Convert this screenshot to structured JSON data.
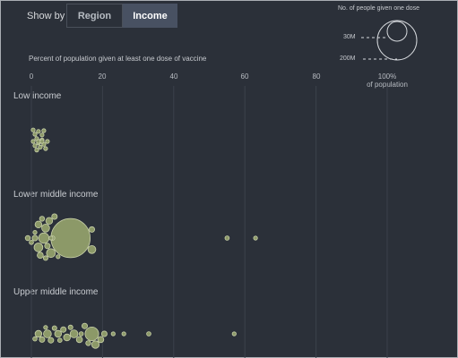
{
  "controls": {
    "show_by_label": "Show by",
    "options": [
      "Region",
      "Income"
    ],
    "selected": "Income"
  },
  "legend": {
    "title": "No. of people given one dose",
    "sizes": [
      "30M",
      "200M"
    ]
  },
  "colors": {
    "background": "#2b3039",
    "bubble_fill": "#8c9968",
    "bubble_stroke": "#c9d1a9",
    "gridline": "#3b414b",
    "accent_button": "#485162"
  },
  "chart_data": {
    "type": "scatter",
    "encoding": "beeswarm bubble chart, bubble size = people given one dose",
    "xlabel": "Percent of population given at least one dose of vaccine",
    "xlim": [
      0,
      100
    ],
    "xticks": [
      "0",
      "20",
      "40",
      "60",
      "80",
      "100%"
    ],
    "xtick_suffix": "of population",
    "groups": [
      {
        "name": "Low income",
        "countries": [
          {
            "x": 0.5,
            "size_m": 0.3
          },
          {
            "x": 1.0,
            "size_m": 0.3
          },
          {
            "x": 1.5,
            "size_m": 0.4
          },
          {
            "x": 2.0,
            "size_m": 0.3
          },
          {
            "x": 2.5,
            "size_m": 0.4
          },
          {
            "x": 3.0,
            "size_m": 0.3
          },
          {
            "x": 3.5,
            "size_m": 0.3
          },
          {
            "x": 1.0,
            "size_m": 0.4
          },
          {
            "x": 2.0,
            "size_m": 0.3
          },
          {
            "x": 3.0,
            "size_m": 0.4
          },
          {
            "x": 4.0,
            "size_m": 0.3
          },
          {
            "x": 1.5,
            "size_m": 0.3
          },
          {
            "x": 2.5,
            "size_m": 0.3
          },
          {
            "x": 3.5,
            "size_m": 0.3
          },
          {
            "x": 0.5,
            "size_m": 0.3
          },
          {
            "x": 2.0,
            "size_m": 0.4
          },
          {
            "x": 4.5,
            "size_m": 0.3
          },
          {
            "x": 3.0,
            "size_m": 0.3
          }
        ]
      },
      {
        "name": "Lower middle income",
        "countries": [
          {
            "x": 11.0,
            "size_m": 50
          },
          {
            "x": 2.0,
            "size_m": 2.5
          },
          {
            "x": 3.5,
            "size_m": 3.5
          },
          {
            "x": 5.5,
            "size_m": 2.5
          },
          {
            "x": 4.0,
            "size_m": 2.0
          },
          {
            "x": 2.0,
            "size_m": 1.5
          },
          {
            "x": -1.0,
            "size_m": 0.8
          },
          {
            "x": 1.0,
            "size_m": 1.0
          },
          {
            "x": 2.5,
            "size_m": 1.2
          },
          {
            "x": 3.0,
            "size_m": 0.8
          },
          {
            "x": 5.0,
            "size_m": 1.5
          },
          {
            "x": 4.5,
            "size_m": 1.0
          },
          {
            "x": 6.5,
            "size_m": 1.0
          },
          {
            "x": 6.0,
            "size_m": 0.6
          },
          {
            "x": 0.0,
            "size_m": 0.6
          },
          {
            "x": 4.0,
            "size_m": 0.7
          },
          {
            "x": 5.5,
            "size_m": 0.5
          },
          {
            "x": 1.0,
            "size_m": 0.5
          },
          {
            "x": 7.5,
            "size_m": 0.5
          },
          {
            "x": 17.0,
            "size_m": 2.0
          },
          {
            "x": 17.0,
            "size_m": 1.0
          },
          {
            "x": 55.0,
            "size_m": 0.6
          },
          {
            "x": 63.0,
            "size_m": 0.3
          }
        ]
      },
      {
        "name": "Upper middle income",
        "countries": [
          {
            "x": 17.0,
            "size_m": 6
          },
          {
            "x": 2.0,
            "size_m": 1.5
          },
          {
            "x": 4.5,
            "size_m": 2.0
          },
          {
            "x": 7.5,
            "size_m": 1.5
          },
          {
            "x": 10.0,
            "size_m": 1.5
          },
          {
            "x": 12.0,
            "size_m": 2.0
          },
          {
            "x": 13.5,
            "size_m": 1.2
          },
          {
            "x": 3.0,
            "size_m": 1.0
          },
          {
            "x": 5.5,
            "size_m": 1.0
          },
          {
            "x": 9.0,
            "size_m": 1.0
          },
          {
            "x": 18.0,
            "size_m": 1.8
          },
          {
            "x": 15.0,
            "size_m": 1.0
          },
          {
            "x": 16.0,
            "size_m": 0.8
          },
          {
            "x": 19.5,
            "size_m": 1.2
          },
          {
            "x": 20.5,
            "size_m": 1.0
          },
          {
            "x": 1.0,
            "size_m": 0.6
          },
          {
            "x": 6.5,
            "size_m": 0.7
          },
          {
            "x": 8.0,
            "size_m": 0.6
          },
          {
            "x": 11.0,
            "size_m": 0.7
          },
          {
            "x": 14.0,
            "size_m": 0.6
          },
          {
            "x": 4.0,
            "size_m": 0.5
          },
          {
            "x": 23.0,
            "size_m": 0.3
          },
          {
            "x": 26.0,
            "size_m": 0.2
          },
          {
            "x": 33.0,
            "size_m": 0.6
          },
          {
            "x": 57.0,
            "size_m": 0.3
          }
        ]
      }
    ]
  }
}
